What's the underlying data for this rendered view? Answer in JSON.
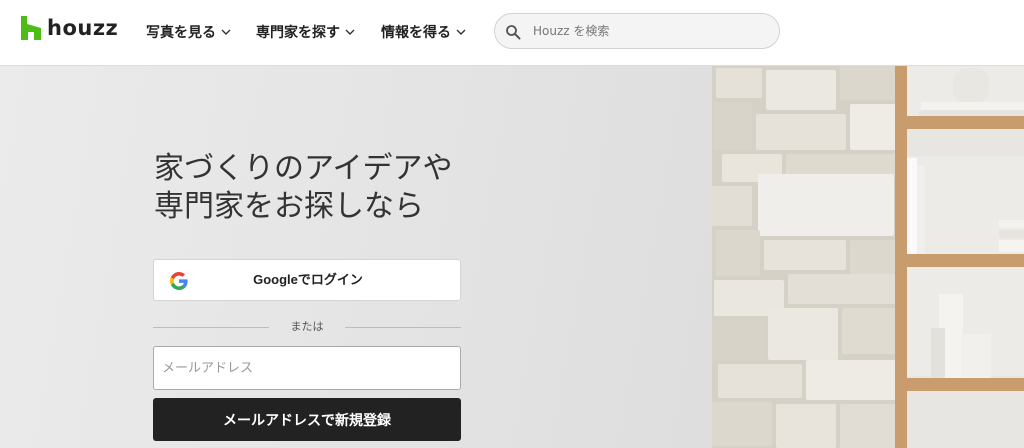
{
  "brand": {
    "name": "houzz",
    "color": "#4dbc15",
    "logo_icon": "houzz-h-icon"
  },
  "nav": [
    {
      "label": "写真を見る",
      "icon": "chevron-down-icon"
    },
    {
      "label": "専門家を探す",
      "icon": "chevron-down-icon"
    },
    {
      "label": "情報を得る",
      "icon": "chevron-down-icon"
    }
  ],
  "search": {
    "placeholder": "Houzz を検索",
    "value": "",
    "icon": "search-icon"
  },
  "hero": {
    "headline_line1": "家づくりのアイデアや",
    "headline_line2": "専門家をお探しなら"
  },
  "signin": {
    "google_label": "Googleでログイン",
    "google_icon": "google-g-icon",
    "divider_text": "または",
    "email_placeholder": "メールアドレス",
    "email_value": "",
    "signup_label": "メールアドレスで新規登録"
  },
  "colors": {
    "button_dark": "#222222",
    "header_bg": "#ffffff",
    "wood": "#c89c6c"
  }
}
